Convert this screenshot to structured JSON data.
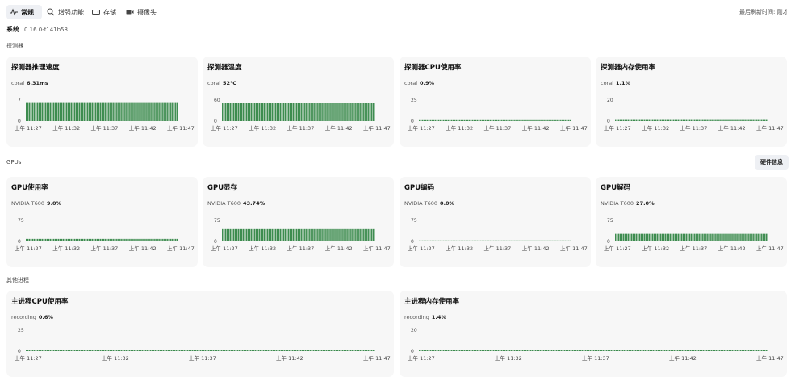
{
  "tabs": [
    {
      "label": "常规",
      "icon": "activity-icon",
      "active": true
    },
    {
      "label": "增强功能",
      "icon": "search-icon",
      "active": false
    },
    {
      "label": "存储",
      "icon": "drive-icon",
      "active": false
    },
    {
      "label": "摄像头",
      "icon": "video-icon",
      "active": false
    }
  ],
  "refresh_label": "最后刷新时间: 刚才",
  "system": {
    "label": "系统",
    "version": "0.16.0-f141b58"
  },
  "sections": {
    "detector": "探测器",
    "gpus": "GPUs",
    "other": "其他进程"
  },
  "hardware_button": "硬件信息",
  "time_ticks": [
    "上午 11:27",
    "上午 11:32",
    "上午 11:37",
    "上午 11:42",
    "上午 11:47"
  ],
  "cards": [
    {
      "id": "detector-inference",
      "title": "探测器推理速度",
      "source": "coral",
      "value": "6.31ms"
    },
    {
      "id": "detector-temp",
      "title": "探测器温度",
      "source": "coral",
      "value": "52°C"
    },
    {
      "id": "detector-cpu",
      "title": "探测器CPU使用率",
      "source": "coral",
      "value": "0.9%"
    },
    {
      "id": "detector-mem",
      "title": "探测器内存使用率",
      "source": "coral",
      "value": "1.1%"
    },
    {
      "id": "gpu-usage",
      "title": "GPU使用率",
      "source": "NVIDIA T600",
      "value": "9.0%"
    },
    {
      "id": "gpu-memory",
      "title": "GPU显存",
      "source": "NVIDIA T600",
      "value": "43.74%"
    },
    {
      "id": "gpu-encode",
      "title": "GPU编码",
      "source": "NVIDIA T600",
      "value": "0.0%"
    },
    {
      "id": "gpu-decode",
      "title": "GPU解码",
      "source": "NVIDIA T600",
      "value": "27.0%"
    },
    {
      "id": "main-cpu",
      "title": "主进程CPU使用率",
      "source": "recording",
      "value": "0.6%"
    },
    {
      "id": "main-mem",
      "title": "主进程内存使用率",
      "source": "recording",
      "value": "1.4%"
    }
  ],
  "chart_data": [
    {
      "type": "bar",
      "id": "detector-inference",
      "y_ticks": [
        "7",
        "0"
      ],
      "ylim": [
        0,
        7
      ],
      "level": 6.3,
      "color": "#3d8c4f",
      "x_ticks": [
        "上午 11:27",
        "上午 11:32",
        "上午 11:37",
        "上午 11:42",
        "上午 11:47"
      ]
    },
    {
      "type": "bar",
      "id": "detector-temp",
      "y_ticks": [
        "60",
        "0"
      ],
      "ylim": [
        0,
        60
      ],
      "level": 52,
      "color": "#3d8c4f",
      "x_ticks": [
        "上午 11:27",
        "上午 11:32",
        "上午 11:37",
        "上午 11:42",
        "上午 11:47"
      ]
    },
    {
      "type": "bar",
      "id": "detector-cpu",
      "y_ticks": [
        "25",
        "0"
      ],
      "ylim": [
        0,
        25
      ],
      "level": 0.9,
      "color": "#3d8c4f",
      "x_ticks": [
        "上午 11:27",
        "上午 11:32",
        "上午 11:37",
        "上午 11:42",
        "上午 11:47"
      ]
    },
    {
      "type": "bar",
      "id": "detector-mem",
      "y_ticks": [
        "20",
        "0"
      ],
      "ylim": [
        0,
        20
      ],
      "level": 1.1,
      "color": "#3d8c4f",
      "x_ticks": [
        "上午 11:27",
        "上午 11:32",
        "上午 11:37",
        "上午 11:42",
        "上午 11:47"
      ]
    },
    {
      "type": "bar",
      "id": "gpu-usage",
      "y_ticks": [
        "75",
        "0"
      ],
      "ylim": [
        0,
        75
      ],
      "level": 9.0,
      "color": "#3d8c4f",
      "x_ticks": [
        "上午 11:27",
        "上午 11:32",
        "上午 11:37",
        "上午 11:42",
        "上午 11:47"
      ]
    },
    {
      "type": "bar",
      "id": "gpu-memory",
      "y_ticks": [
        "75",
        "0"
      ],
      "ylim": [
        0,
        75
      ],
      "level": 43.74,
      "color": "#3d8c4f",
      "x_ticks": [
        "上午 11:27",
        "上午 11:32",
        "上午 11:37",
        "上午 11:42",
        "上午 11:47"
      ]
    },
    {
      "type": "bar",
      "id": "gpu-encode",
      "y_ticks": [
        "75",
        "0"
      ],
      "ylim": [
        0,
        75
      ],
      "level": 0.0,
      "color": "#3d8c4f",
      "x_ticks": [
        "上午 11:27",
        "上午 11:32",
        "上午 11:37",
        "上午 11:42",
        "上午 11:47"
      ]
    },
    {
      "type": "bar",
      "id": "gpu-decode",
      "y_ticks": [
        "75",
        "0"
      ],
      "ylim": [
        0,
        75
      ],
      "level": 27.0,
      "color": "#3d8c4f",
      "x_ticks": [
        "上午 11:27",
        "上午 11:32",
        "上午 11:37",
        "上午 11:42",
        "上午 11:47"
      ]
    },
    {
      "type": "bar",
      "id": "main-cpu",
      "y_ticks": [
        "25",
        "0"
      ],
      "ylim": [
        0,
        25
      ],
      "level": 0.6,
      "color": "#3d8c4f",
      "x_ticks": [
        "上午 11:27",
        "上午 11:32",
        "上午 11:37",
        "上午 11:42",
        "上午 11:47"
      ]
    },
    {
      "type": "bar",
      "id": "main-mem",
      "y_ticks": [
        "20",
        "0"
      ],
      "ylim": [
        0,
        20
      ],
      "level": 1.4,
      "color": "#3d8c4f",
      "x_ticks": [
        "上午 11:27",
        "上午 11:32",
        "上午 11:37",
        "上午 11:42",
        "上午 11:47"
      ]
    }
  ]
}
